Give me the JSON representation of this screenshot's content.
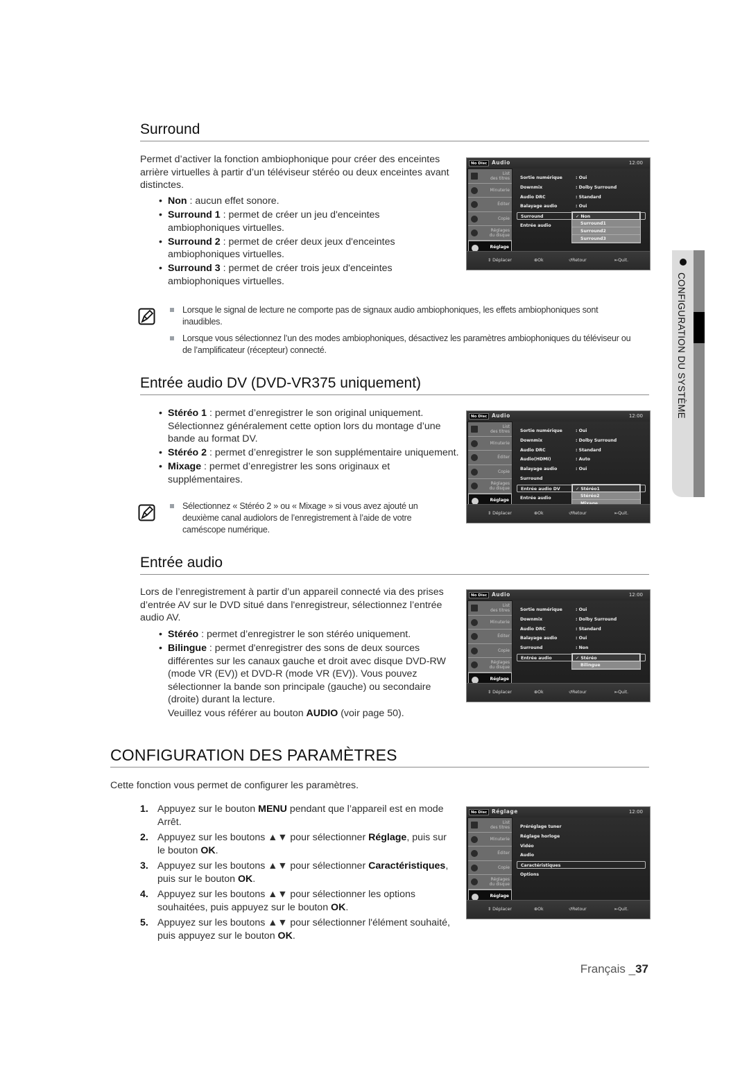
{
  "sections": {
    "surround": {
      "heading": "Surround",
      "intro": "Permet d’activer la fonction ambiophonique pour créer des enceintes arrière virtuelles à partir d’un téléviseur stéréo ou deux enceintes avant distinctes.",
      "bullets": [
        {
          "term": "Non",
          "text": " : aucun effet sonore."
        },
        {
          "term": "Surround 1",
          "text": " : permet de créer un jeu d'enceintes ambiophoniques virtuelles."
        },
        {
          "term": "Surround 2",
          "text": " : permet de créer deux jeux d'enceintes ambiophoniques virtuelles."
        },
        {
          "term": "Surround 3",
          "text": " : permet de créer trois jeux d'enceintes ambiophoniques virtuelles."
        }
      ],
      "notes": [
        "Lorsque le signal de lecture ne comporte pas de signaux audio ambiophoniques, les effets ambiophoniques sont inaudibles.",
        "Lorsque vous sélectionnez l’un des modes ambiophoniques, désactivez les paramètres ambiophoniques du téléviseur ou de l’amplificateur (récepteur) connecté."
      ]
    },
    "dv": {
      "heading": "Entrée audio DV (DVD-VR375 uniquement)",
      "bullets": [
        {
          "term": "Stéréo 1",
          "text": " : permet d’enregistrer le son original uniquement. Sélectionnez généralement cette option lors du montage d’une bande au format DV."
        },
        {
          "term": "Stéréo 2",
          "text": " : permet d’enregistrer le son supplémentaire uniquement."
        },
        {
          "term": "Mixage",
          "text": " : permet d’enregistrer les sons originaux et supplémentaires."
        }
      ],
      "notes": [
        "Sélectionnez « Stéréo 2 » ou « Mixage » si vous avez ajouté un deuxième canal audiolors de l’enregistrement à l’aide de votre caméscope numérique."
      ]
    },
    "audio_in": {
      "heading": "Entrée audio",
      "intro": "Lors de l’enregistrement à partir d’un appareil connecté via des prises d’entrée AV sur le DVD situé dans l'enregistreur, sélectionnez l’entrée audio AV.",
      "bullets": [
        {
          "term": "Stéréo",
          "text": " : permet d’enregistrer le son stéréo uniquement."
        },
        {
          "term": "Bilingue",
          "text": " : permet d'enregistrer des sons de deux sources différentes sur les canaux gauche et droit avec disque DVD-RW (mode VR (EV)) et DVD-R (mode VR (EV)). Vous pouvez sélectionner la bande son principale (gauche) ou secondaire (droite) durant la lecture."
        }
      ],
      "ref_pre": "Veuillez vous référer au bouton ",
      "ref_term": "AUDIO",
      "ref_post": " (voir page 50)."
    },
    "config": {
      "heading": "CONFIGURATION DES PARAMÈTRES",
      "intro": "Cette fonction vous permet de configurer les paramètres.",
      "steps": [
        {
          "num": "1.",
          "parts": [
            "Appuyez sur le bouton ",
            "MENU",
            " pendant que l’appareil est en mode Arrêt."
          ]
        },
        {
          "num": "2.",
          "parts": [
            "Appuyez sur les boutons ▲▼ pour sélectionner ",
            "Réglage",
            ", puis sur le bouton ",
            "OK",
            "."
          ]
        },
        {
          "num": "3.",
          "parts": [
            "Appuyez sur les boutons ▲▼ pour sélectionner ",
            "Caractéristiques",
            ", puis sur le bouton ",
            "OK",
            "."
          ]
        },
        {
          "num": "4.",
          "parts": [
            "Appuyez sur les boutons ▲▼ pour sélectionner les options souhaitées, puis appuyez sur le bouton ",
            "OK",
            "."
          ]
        },
        {
          "num": "5.",
          "parts": [
            "Appuyez sur les boutons ▲▼ pour sélectionner l'élément souhaité, puis appuyez sur le bouton ",
            "OK",
            "."
          ]
        }
      ]
    }
  },
  "osd_common": {
    "nodisc": "No Disc",
    "time": "12:00",
    "tabs": [
      {
        "label": "List\ndes titres",
        "icon": "film-icon"
      },
      {
        "label": "Minuterie",
        "icon": "clock-icon"
      },
      {
        "label": "Éditer",
        "icon": "scissors-icon"
      },
      {
        "label": "Copie",
        "icon": "copy-icon"
      },
      {
        "label": "Réglages\ndu disque",
        "icon": "disc-icon"
      },
      {
        "label": "Réglage",
        "icon": "gear-icon"
      }
    ],
    "footer": {
      "move": "⇕ Déplacer",
      "ok": "⊕Ok",
      "back": "↺Retour",
      "quit": "⇤Quit."
    }
  },
  "osds": [
    {
      "title": "Audio",
      "rows": [
        {
          "k": "Sortie numérique",
          "v": ": Oui"
        },
        {
          "k": "Downmix",
          "v": ": Dolby Surround"
        },
        {
          "k": "Audio DRC",
          "v": ": Standard"
        },
        {
          "k": "Balayage audio",
          "v": ": Oui"
        },
        {
          "k": "Surround",
          "v": ""
        },
        {
          "k": "Entrée audio",
          "v": ""
        }
      ],
      "selected_row": 4,
      "popup": [
        "✓ Non",
        "Surround1",
        "Surround2",
        "Surround3"
      ]
    },
    {
      "title": "Audio",
      "rows": [
        {
          "k": "Sortie numérique",
          "v": ": Oui"
        },
        {
          "k": "Downmix",
          "v": ": Dolby Surround"
        },
        {
          "k": "Audio DRC",
          "v": ": Standard"
        },
        {
          "k": "Audio(HDMI)",
          "v": ": Auto"
        },
        {
          "k": "Balayage audio",
          "v": ": Oui"
        },
        {
          "k": "Surround",
          "v": ""
        },
        {
          "k": "Entrée audio DV",
          "v": ""
        },
        {
          "k": "Entrée audio",
          "v": ""
        }
      ],
      "selected_row": 6,
      "popup": [
        "✓ Stéréo1",
        "Stéréo2",
        "Mixage"
      ]
    },
    {
      "title": "Audio",
      "rows": [
        {
          "k": "Sortie numérique",
          "v": ": Oui"
        },
        {
          "k": "Downmix",
          "v": ": Dolby Surround"
        },
        {
          "k": "Audio DRC",
          "v": ": Standard"
        },
        {
          "k": "Balayage audio",
          "v": ": Oui"
        },
        {
          "k": "Surround",
          "v": ": Non"
        },
        {
          "k": "Entrée audio",
          "v": ""
        }
      ],
      "selected_row": 5,
      "popup": [
        "✓ Stéréo",
        "Bilingue"
      ]
    },
    {
      "title": "Réglage",
      "rows": [
        {
          "k": "Préréglage tuner",
          "v": ""
        },
        {
          "k": "Réglage horloge",
          "v": ""
        },
        {
          "k": "Vidéo",
          "v": ""
        },
        {
          "k": "Audio",
          "v": ""
        },
        {
          "k": "Caractéristiques",
          "v": ""
        },
        {
          "k": "Options",
          "v": ""
        }
      ],
      "selected_row": 4,
      "popup": []
    }
  ],
  "side_tab": {
    "label": "CONFIGURATION DU SYSTÈME"
  },
  "footer": {
    "lang": "Français _",
    "page": "37"
  }
}
